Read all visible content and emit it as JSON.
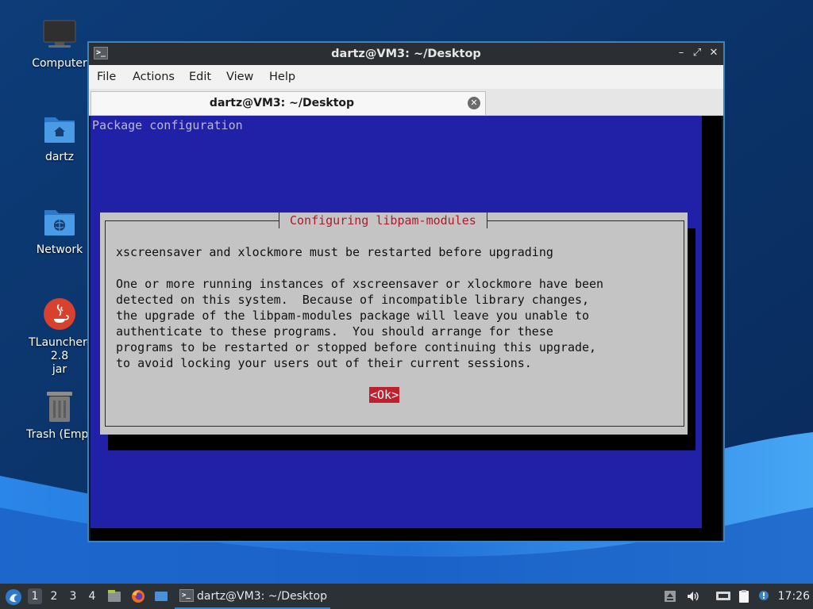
{
  "desktop": {
    "icons": [
      {
        "label": "Computer",
        "icon": "monitor-icon"
      },
      {
        "label": "dartz",
        "icon": "home-folder-icon"
      },
      {
        "label": "Network",
        "icon": "network-folder-icon"
      },
      {
        "label": "TLauncher-2.8\njar",
        "icon": "java-icon"
      },
      {
        "label": "Trash (Empt",
        "icon": "trash-icon"
      }
    ]
  },
  "window": {
    "title": "dartz@VM3: ~/Desktop",
    "menu": [
      "File",
      "Actions",
      "Edit",
      "View",
      "Help"
    ],
    "tab_title": "dartz@VM3: ~/Desktop"
  },
  "terminal": {
    "header": "Package configuration",
    "dialog": {
      "title": "Configuring libpam-modules",
      "text": "xscreensaver and xlockmore must be restarted before upgrading\n\nOne or more running instances of xscreensaver or xlockmore have been\ndetected on this system.  Because of incompatible library changes,\nthe upgrade of the libpam-modules package will leave you unable to\nauthenticate to these programs.  You should arrange for these\nprograms to be restarted or stopped before continuing this upgrade,\nto avoid locking your users out of their current sessions.",
      "ok_label": "<Ok>"
    }
  },
  "taskbar": {
    "workspaces": [
      "1",
      "2",
      "3",
      "4"
    ],
    "active_workspace": "1",
    "task_label": "dartz@VM3: ~/Desktop",
    "clock": "17:26"
  },
  "colors": {
    "terminal_blue": "#2121a8",
    "dialog_gray": "#c4c4c4",
    "dialog_title_red": "#b0192a",
    "ok_button_red": "#c0202e",
    "window_accent": "#3b82c4"
  }
}
